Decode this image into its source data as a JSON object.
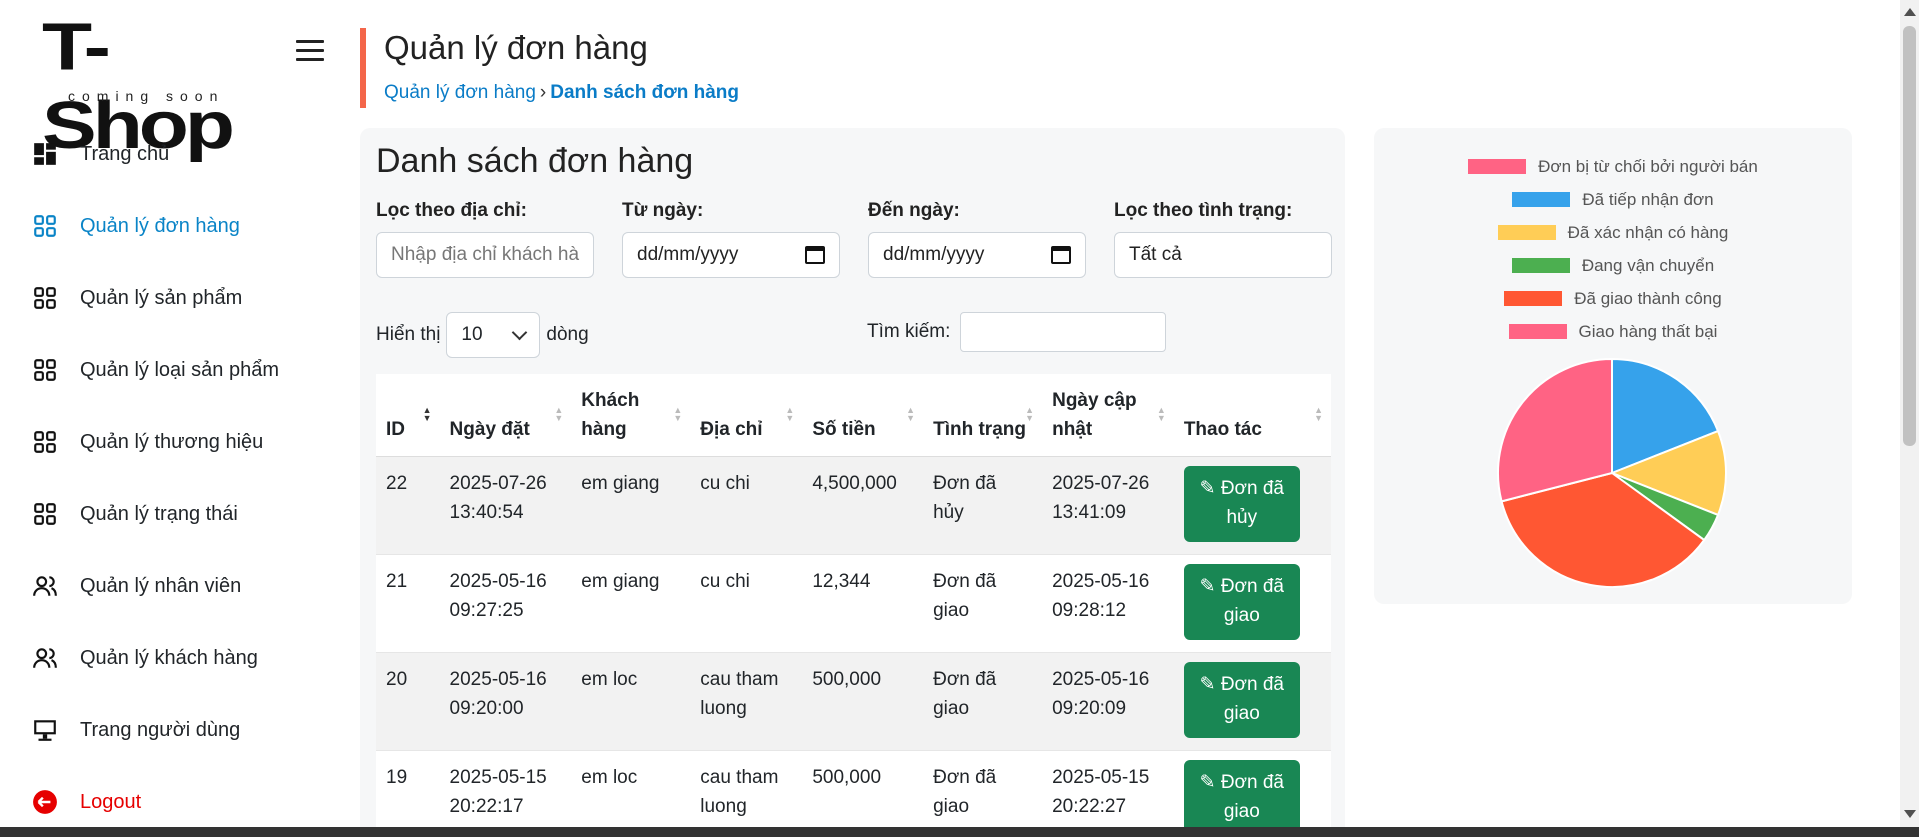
{
  "logo": {
    "main": "T-Shop",
    "sub": "coming soon"
  },
  "sidebar": {
    "items": [
      {
        "label": "Trang chủ",
        "icon": "dashboard-icon"
      },
      {
        "label": "Quản lý đơn hàng",
        "icon": "grid-icon"
      },
      {
        "label": "Quản lý sản phẩm",
        "icon": "grid-icon"
      },
      {
        "label": "Quản lý loại sản phẩm",
        "icon": "grid-icon"
      },
      {
        "label": "Quản lý thương hiệu",
        "icon": "grid-icon"
      },
      {
        "label": "Quản lý trạng thái",
        "icon": "grid-icon"
      },
      {
        "label": "Quản lý nhân viên",
        "icon": "users-icon"
      },
      {
        "label": "Quản lý khách hàng",
        "icon": "users-icon"
      },
      {
        "label": "Trang người dùng",
        "icon": "monitor-icon"
      },
      {
        "label": "Logout",
        "icon": "logout-icon"
      }
    ]
  },
  "header": {
    "title": "Quản lý đơn hàng",
    "breadcrumb_parent": "Quản lý đơn hàng",
    "breadcrumb_sep": "›",
    "breadcrumb_current": "Danh sách đơn hàng"
  },
  "panel": {
    "title": "Danh sách đơn hàng",
    "filters": {
      "address_label": "Lọc theo địa chỉ:",
      "address_placeholder": "Nhập địa chỉ khách hà",
      "from_label": "Từ ngày:",
      "from_value": "dd/mm/yyyy",
      "to_label": "Đến ngày:",
      "to_value": "dd/mm/yyyy",
      "status_label": "Lọc theo tình trạng:",
      "status_value": "Tất cả"
    },
    "show_label": "Hiển thị",
    "show_value": "10",
    "rows_label": "dòng",
    "search_label": "Tìm kiếm:"
  },
  "table": {
    "headers": [
      "ID",
      "Ngày đặt",
      "Khách hàng",
      "Địa chỉ",
      "Số tiền",
      "Tình trạng",
      "Ngày cập nhật",
      "Thao tác"
    ],
    "rows": [
      {
        "id": "22",
        "date": "2025-07-26 13:40:54",
        "customer": "em giang",
        "address": "cu chi",
        "amount": "4,500,000",
        "status": "Đơn đã hủy",
        "updated": "2025-07-26 13:41:09",
        "action": "Đơn đã hủy"
      },
      {
        "id": "21",
        "date": "2025-05-16 09:27:25",
        "customer": "em giang",
        "address": "cu chi",
        "amount": "12,344",
        "status": "Đơn đã giao",
        "updated": "2025-05-16 09:28:12",
        "action": "Đơn đã giao"
      },
      {
        "id": "20",
        "date": "2025-05-16 09:20:00",
        "customer": "em loc",
        "address": "cau tham luong",
        "amount": "500,000",
        "status": "Đơn đã giao",
        "updated": "2025-05-16 09:20:09",
        "action": "Đơn đã giao"
      },
      {
        "id": "19",
        "date": "2025-05-15 20:22:17",
        "customer": "em loc",
        "address": "cau tham luong",
        "amount": "500,000",
        "status": "Đơn đã giao",
        "updated": "2025-05-15 20:22:27",
        "action": "Đơn đã giao"
      }
    ]
  },
  "chart_data": {
    "type": "pie",
    "categories": [
      "Đơn bị từ chối bởi người bán",
      "Đã tiếp nhận đơn",
      "Đã xác nhận có hàng",
      "Đang vận chuyển",
      "Đã giao thành công",
      "Giao hàng thất bại"
    ],
    "values": [
      0,
      19,
      12,
      4,
      36,
      29
    ],
    "colors": [
      "#ff6384",
      "#36a2eb",
      "#ffcd56",
      "#4caf50",
      "#ff5733",
      "#ff6384"
    ],
    "legend": "top"
  }
}
